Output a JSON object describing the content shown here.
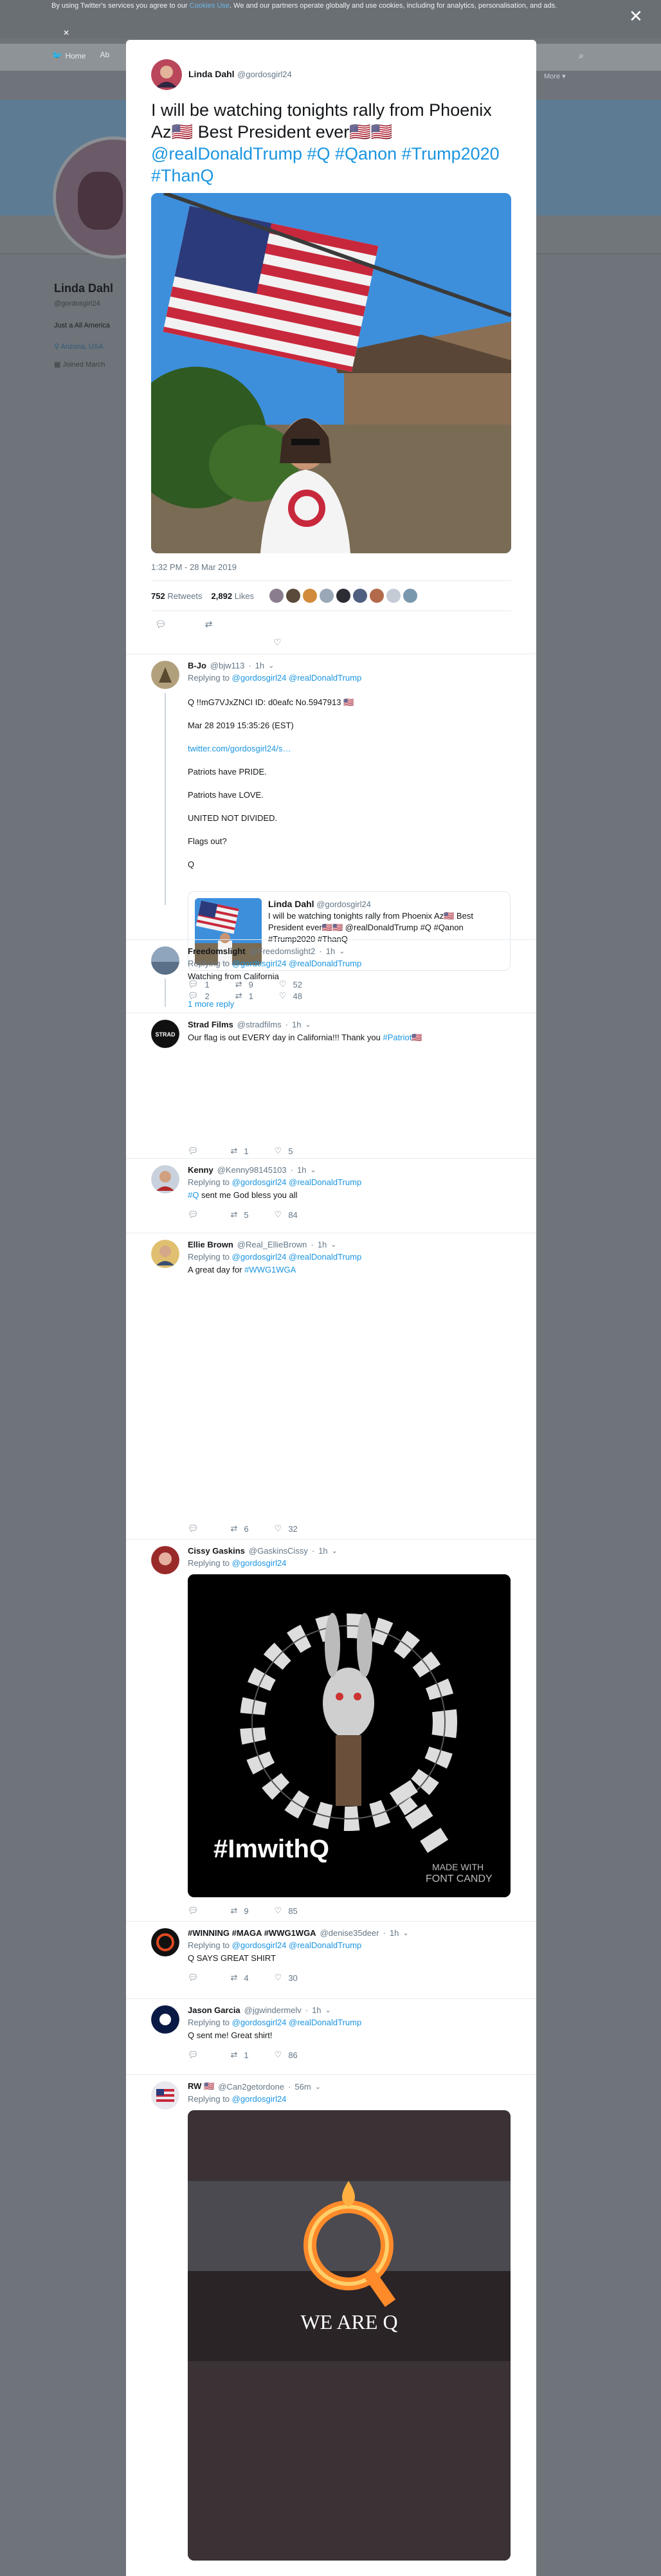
{
  "cookie": {
    "text_before": "By using Twitter's services you agree to our ",
    "link": "Cookies Use",
    "text_after": ". We and our partners operate globally and use cookies, including for analytics, personalisation, and ads.",
    "close_icon": "close-icon"
  },
  "background": {
    "nav": [
      "Home",
      "Ab"
    ],
    "more": "More",
    "name": "Linda Dahl",
    "handle": "@gordosgirl24",
    "bio": "Just a All America",
    "location": "Arizona, USA",
    "joined": "Joined March"
  },
  "tweet": {
    "author": "Linda Dahl",
    "handle": "@gordosgirl24",
    "text_plain": "I will be watching tonights rally from Phoenix Az🇺🇸 Best President ever🇺🇸🇺🇸",
    "text_tags": "@realDonaldTrump #Q #Qanon #Trump2020 #ThanQ",
    "timestamp": "1:32 PM - 28 Mar 2019",
    "retweets": "752",
    "retweets_label": "Retweets",
    "likes": "2,892",
    "likes_label": "Likes"
  },
  "replies": [
    {
      "name": "B-Jo",
      "handle": "@bjw113",
      "time": "1h",
      "replying_prefix": "Replying to",
      "replying_to": "@gordosgirl24 @realDonaldTrump",
      "lines": [
        "Q !!mG7VJxZNCI ID: d0eafc No.5947913 🇺🇸",
        "Mar 28 2019 15:35:26 (EST)"
      ],
      "link": "twitter.com/gordosgirl24/s…",
      "lines2": [
        "Patriots have PRIDE.",
        "Patriots have LOVE.",
        "UNITED NOT DIVIDED.",
        "Flags out?",
        "Q"
      ],
      "quote_name": "Linda Dahl",
      "quote_handle": "@gordosgirl24",
      "quote_text": "I will be watching tonights rally from Phoenix Az🇺🇸 Best President ever🇺🇸🇺🇸 @realDonaldTrump #Q #Qanon #Trump2020 #ThanQ",
      "replies": "1",
      "retweets": "9",
      "likes": "52",
      "more": "1 more reply"
    },
    {
      "name": "Freedomslight",
      "handle": "@Freedomslight2",
      "time": "1h",
      "replying_prefix": "Replying to",
      "replying_to": "@gordosgirl24 @realDonaldTrump",
      "text": "Watching from California",
      "replies": "2",
      "retweets": "1",
      "likes": "48"
    },
    {
      "name": "Strad Films",
      "handle": "@stradfilms",
      "time": "1h",
      "text_plain": "Our flag is out EVERY day in California!!! Thank you ",
      "text_tag": "#Patriot🇺🇸",
      "replies": "",
      "retweets": "1",
      "likes": "5"
    },
    {
      "name": "Kenny",
      "handle": "@Kenny98145103",
      "time": "1h",
      "replying_prefix": "Replying to",
      "replying_to": "@gordosgirl24 @realDonaldTrump",
      "text_tag": "#Q",
      "text_plain": " sent me God bless you all",
      "replies": "",
      "retweets": "5",
      "likes": "84"
    },
    {
      "name": "Ellie Brown",
      "handle": "@Real_EllieBrown",
      "time": "1h",
      "replying_prefix": "Replying to",
      "replying_to": "@gordosgirl24 @realDonaldTrump",
      "text_plain": "A great day for ",
      "text_tag": "#WWG1WGA",
      "replies": "",
      "retweets": "6",
      "likes": "32"
    },
    {
      "name": "Cissy Gaskins",
      "handle": "@GaskinsCissy",
      "time": "1h",
      "replying_prefix": "Replying to",
      "replying_to": "@gordosgirl24",
      "image_caption": "#ImwithQ",
      "image_watermark_1": "MADE WITH",
      "image_watermark_2": "FONT CANDY",
      "replies": "",
      "retweets": "9",
      "likes": "85"
    },
    {
      "name": "#WINNING #MAGA #WWG1WGA",
      "handle": "@denise35deer",
      "time": "1h",
      "replying_prefix": "Replying to",
      "replying_to": "@gordosgirl24 @realDonaldTrump",
      "text": "Q SAYS GREAT SHIRT",
      "replies": "",
      "retweets": "4",
      "likes": "30"
    },
    {
      "name": "Jason Garcia",
      "handle": "@jgwindermelv",
      "time": "1h",
      "replying_prefix": "Replying to",
      "replying_to": "@gordosgirl24 @realDonaldTrump",
      "text": "Q sent me! Great shirt!",
      "replies": "",
      "retweets": "1",
      "likes": "86"
    },
    {
      "name": "RW 🇺🇸",
      "handle": "@Can2getordone",
      "time": "56m",
      "replying_prefix": "Replying to",
      "replying_to": "@gordosgirl24",
      "image_caption": "WE ARE Q"
    }
  ],
  "colors": {
    "link": "#1b95e0",
    "muted": "#657786",
    "overlay": "#6e7479"
  }
}
